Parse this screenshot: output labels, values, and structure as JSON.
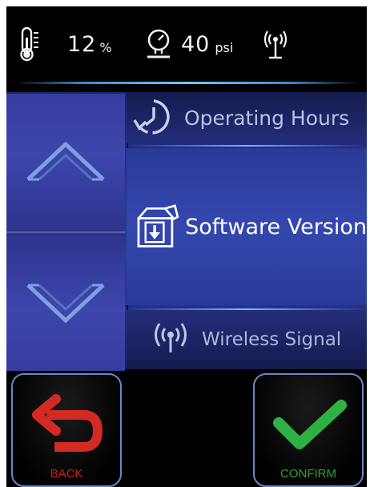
{
  "status": {
    "thermometer_icon": "thermometer-icon",
    "humidity_value": "12",
    "humidity_unit": "%",
    "pressure_icon": "pressure-gauge-icon",
    "pressure_value": "40",
    "pressure_unit": "psi",
    "signal_icon": "wireless-antenna-icon"
  },
  "navigation": {
    "up_icon": "chevron-up-icon",
    "down_icon": "chevron-down-icon"
  },
  "menu": {
    "items": [
      {
        "label": "Operating Hours",
        "icon": "clock-history-icon",
        "selected": false
      },
      {
        "label": "Software Version",
        "icon": "download-box-icon",
        "selected": true
      },
      {
        "label": "Wireless Signal",
        "icon": "wireless-signal-icon",
        "selected": false
      }
    ]
  },
  "actions": {
    "back_label": "BACK",
    "back_icon": "undo-arrow-icon",
    "confirm_label": "CONFIRM",
    "confirm_icon": "checkmark-icon"
  },
  "colors": {
    "background": "#000000",
    "panel": "#2b3a98",
    "accent_glow": "#6fb7ff",
    "back_red": "#c8201f",
    "confirm_green": "#28a33a",
    "button_border": "#6e86c8"
  }
}
